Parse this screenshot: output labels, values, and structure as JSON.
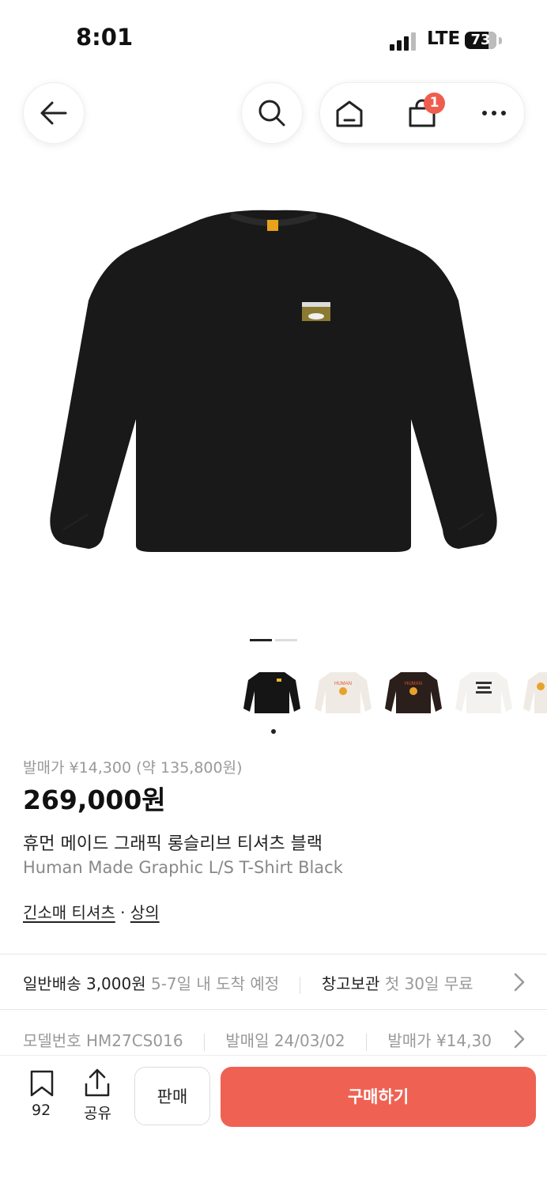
{
  "status_bar": {
    "time": "8:01",
    "network": "LTE",
    "battery": "73"
  },
  "nav": {
    "cart_count": "1"
  },
  "colors": {
    "accent": "#ef6253",
    "badge": "#ef5d4f"
  },
  "product": {
    "release_price": "발매가 ¥14,300 (약 135,800원)",
    "price": "269,000원",
    "name_ko": "휴먼 메이드 그래픽 롱슬리브 티셔츠 블랙",
    "name_en": "Human Made Graphic L/S T-Shirt Black",
    "category_main": "긴소매 티셔츠",
    "category_sep": " · ",
    "category_sub": "상의"
  },
  "thumbnails": [
    "black-longsleeve-thumb",
    "white-longsleeve-thumb",
    "brown-longsleeve-thumb",
    "white-text-longsleeve-thumb",
    "white-partial-thumb"
  ],
  "shipping": {
    "label": "일반배송",
    "fee": "3,000원",
    "eta": "5-7일 내 도착 예정",
    "storage_label": "창고보관",
    "storage_note": "첫 30일 무료"
  },
  "info": {
    "model_label": "모델번호",
    "model_value": "HM27CS016",
    "release_date_label": "발매일",
    "release_date_value": "24/03/02",
    "release_price_label": "발매가",
    "release_price_value": "¥14,30"
  },
  "bottom": {
    "bookmark_count": "92",
    "share_label": "공유",
    "sell_label": "판매",
    "buy_label": "구매하기"
  }
}
